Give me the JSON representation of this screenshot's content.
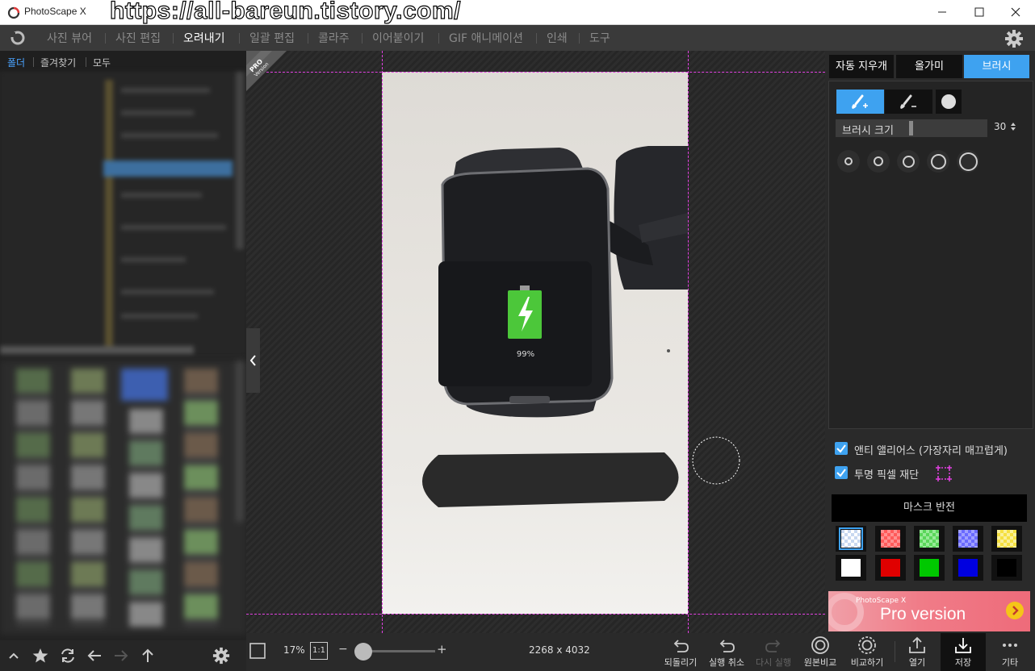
{
  "window": {
    "app_name": "PhotoScape X",
    "watermark": "https://all-bareun.tistory.com/"
  },
  "menu": {
    "items": [
      "사진 뷰어",
      "사진 편집",
      "오려내기",
      "일괄 편집",
      "콜라주",
      "이어붙이기",
      "GIF 애니메이션",
      "인쇄",
      "도구"
    ],
    "active": "오려내기"
  },
  "left_panel": {
    "tabs": [
      "폴더",
      "즐겨찾기",
      "모두"
    ],
    "active_tab": "폴더"
  },
  "canvas": {
    "pro_badge_line1": "PRO",
    "pro_badge_line2": "Version",
    "battery_text": "99%"
  },
  "right_panel": {
    "tabs": [
      "자동 지우개",
      "올가미",
      "브러시"
    ],
    "active_tab": "브러시",
    "brush_size_label": "브러시 크기",
    "brush_size_value": "30",
    "brush_size_fraction": 0.3,
    "antialias_label": "앤티 앨리어스 (가장자리 매끄럽게)",
    "antialias_checked": true,
    "transparent_crop_label": "투명 픽셀 재단",
    "transparent_crop_checked": true,
    "mask_invert_label": "마스크 반전",
    "swatches": [
      "#7fb8ff",
      "#ff5a5a",
      "#5ad65a",
      "#6a6aff",
      "#f5e040",
      "#ffffff",
      "#e00000",
      "#00c800",
      "#0000e0",
      "#000000"
    ],
    "selected_swatch": 0,
    "pro_banner_small": "PhotoScape X",
    "pro_banner_big": "Pro version"
  },
  "bottom_bar": {
    "zoom": "17%",
    "fit_label": "1:1",
    "dimensions": "2268 x 4032",
    "buttons": [
      "되돌리기",
      "실행 취소",
      "다시 실행",
      "원본비교",
      "비교하기",
      "열기",
      "저장",
      "기타"
    ],
    "active_button": "저장"
  },
  "colors": {
    "accent": "#3ea2f0",
    "guide": "#e040e0"
  }
}
